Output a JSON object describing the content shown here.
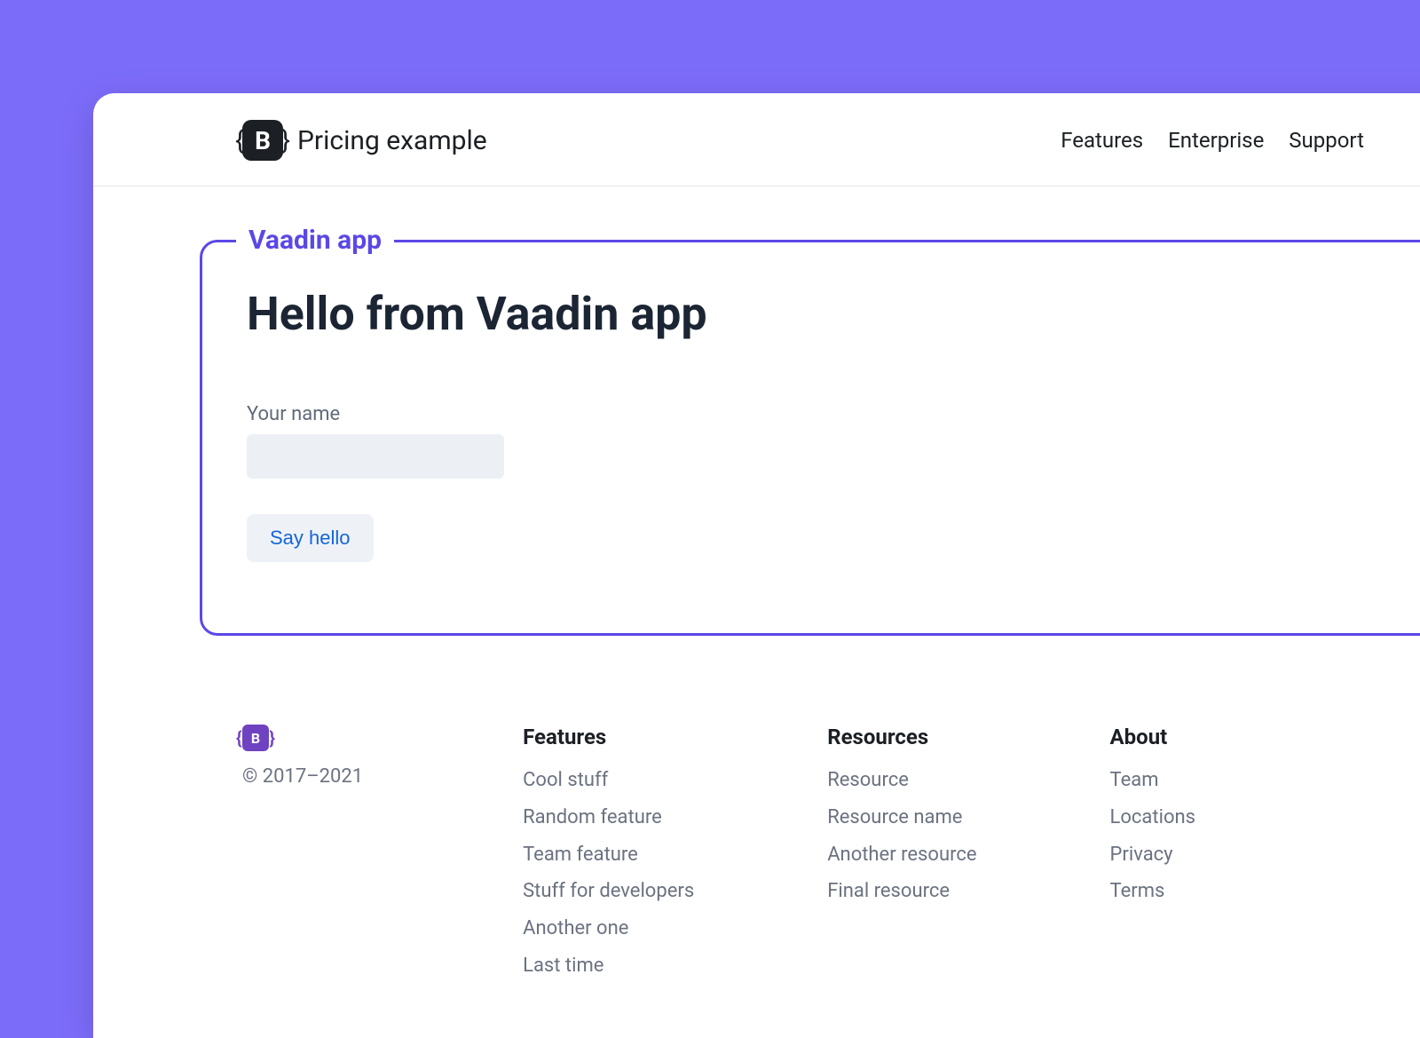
{
  "header": {
    "brand_title": "Pricing example",
    "brand_letter": "B",
    "nav": [
      "Features",
      "Enterprise",
      "Support"
    ]
  },
  "vaadin": {
    "box_label": "Vaadin app",
    "heading": "Hello from Vaadin app",
    "name_label": "Your name",
    "name_value": "",
    "say_hello_label": "Say hello"
  },
  "footer": {
    "logo_letter": "B",
    "copyright": "© 2017–2021",
    "columns": [
      {
        "title": "Features",
        "links": [
          "Cool stuff",
          "Random feature",
          "Team feature",
          "Stuff for developers",
          "Another one",
          "Last time"
        ]
      },
      {
        "title": "Resources",
        "links": [
          "Resource",
          "Resource name",
          "Another resource",
          "Final resource"
        ]
      },
      {
        "title": "About",
        "links": [
          "Team",
          "Locations",
          "Privacy",
          "Terms"
        ]
      }
    ]
  }
}
